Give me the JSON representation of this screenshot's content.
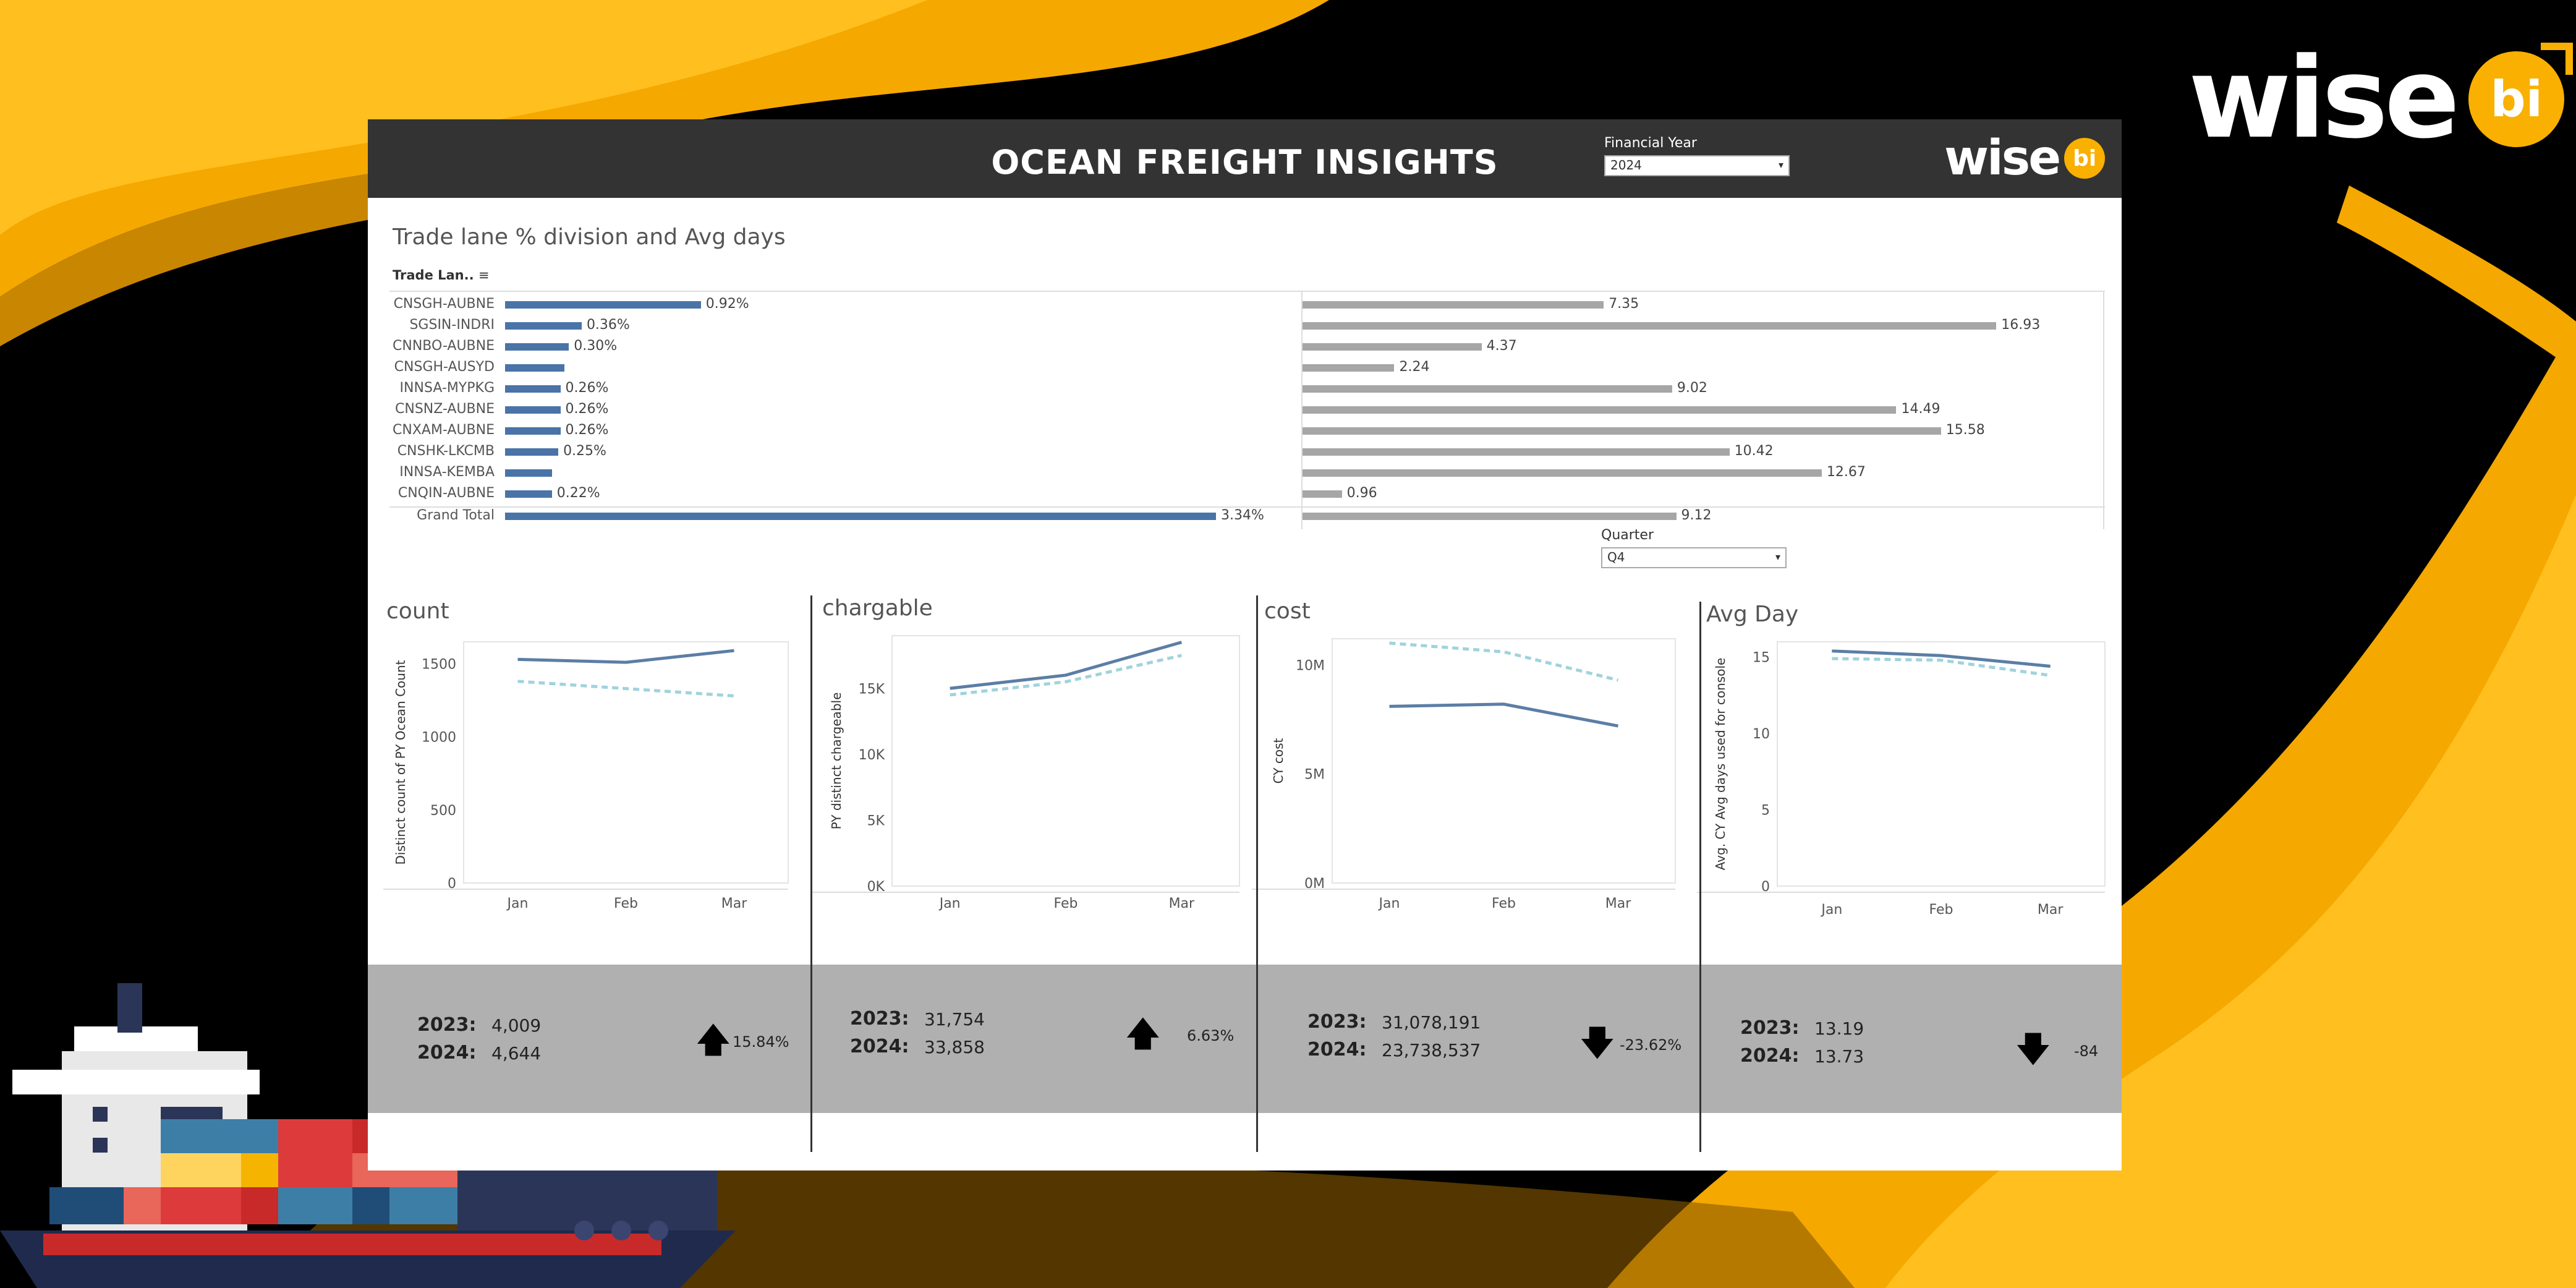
{
  "brand": {
    "word": "wise",
    "badge": "bi"
  },
  "header": {
    "title": "OCEAN FREIGHT INSIGHTS",
    "financial_year_label": "Financial Year",
    "financial_year_value": "2024"
  },
  "trade_section": {
    "title": "Trade lane % division and Avg days",
    "column_header": "Trade Lan..",
    "rows": [
      {
        "lane": "CNSGH-AUBNE",
        "pct": 0.92,
        "pct_label": "0.92%",
        "days": 7.35,
        "days_label": "7.35"
      },
      {
        "lane": "SGSIN-INDRI",
        "pct": 0.36,
        "pct_label": "0.36%",
        "days": 16.93,
        "days_label": "16.93"
      },
      {
        "lane": "CNNBO-AUBNE",
        "pct": 0.3,
        "pct_label": "0.30%",
        "days": 4.37,
        "days_label": "4.37"
      },
      {
        "lane": "CNSGH-AUSYD",
        "pct": 0.28,
        "pct_label": "",
        "days": 2.24,
        "days_label": "2.24"
      },
      {
        "lane": "INNSA-MYPKG",
        "pct": 0.26,
        "pct_label": "0.26%",
        "days": 9.02,
        "days_label": "9.02"
      },
      {
        "lane": "CNSNZ-AUBNE",
        "pct": 0.26,
        "pct_label": "0.26%",
        "days": 14.49,
        "days_label": "14.49"
      },
      {
        "lane": "CNXAM-AUBNE",
        "pct": 0.26,
        "pct_label": "0.26%",
        "days": 15.58,
        "days_label": "15.58"
      },
      {
        "lane": "CNSHK-LKCMB",
        "pct": 0.25,
        "pct_label": "0.25%",
        "days": 10.42,
        "days_label": "10.42"
      },
      {
        "lane": "INNSA-KEMBA",
        "pct": 0.22,
        "pct_label": "",
        "days": 12.67,
        "days_label": "12.67"
      },
      {
        "lane": "CNQIN-AUBNE",
        "pct": 0.22,
        "pct_label": "0.22%",
        "days": 0.96,
        "days_label": "0.96"
      }
    ],
    "grand_total": {
      "lane": "Grand Total",
      "pct": 3.34,
      "pct_label": "3.34%",
      "days": 9.12,
      "days_label": "9.12"
    }
  },
  "quarter": {
    "label": "Quarter",
    "value": "Q4"
  },
  "chart_data": [
    {
      "type": "line",
      "title": "count",
      "ylabel": "Distinct count of PY Ocean Count",
      "categories": [
        "Jan",
        "Feb",
        "Mar"
      ],
      "ylim": [
        0,
        1650
      ],
      "yticks": [
        0,
        500,
        1000,
        1500
      ],
      "ytick_labels": [
        "0",
        "500",
        "1000",
        "1500"
      ],
      "series": [
        {
          "values": [
            1530,
            1510,
            1590
          ],
          "color": "#5b7ea5",
          "style": "solid"
        },
        {
          "values": [
            1380,
            1330,
            1280
          ],
          "color": "#9fd3dc",
          "style": "dashed"
        }
      ]
    },
    {
      "type": "line",
      "title": "chargable",
      "ylabel": "PY distinct chargeable",
      "categories": [
        "Jan",
        "Feb",
        "Mar"
      ],
      "ylim": [
        0,
        19000
      ],
      "yticks": [
        0,
        5000,
        10000,
        15000
      ],
      "ytick_labels": [
        "0K",
        "5K",
        "10K",
        "15K"
      ],
      "series": [
        {
          "values": [
            15000,
            16000,
            18500
          ],
          "color": "#5b7ea5",
          "style": "solid"
        },
        {
          "values": [
            14500,
            15500,
            17500
          ],
          "color": "#9fd3dc",
          "style": "dashed"
        }
      ]
    },
    {
      "type": "line",
      "title": "cost",
      "ylabel": "CY cost",
      "categories": [
        "Jan",
        "Feb",
        "Mar"
      ],
      "ylim": [
        0,
        11200000
      ],
      "yticks": [
        0,
        5000000,
        10000000
      ],
      "ytick_labels": [
        "0M",
        "5M",
        "10M"
      ],
      "series": [
        {
          "values": [
            8100000,
            8200000,
            7200000
          ],
          "color": "#5b7ea5",
          "style": "solid"
        },
        {
          "values": [
            11000000,
            10600000,
            9300000
          ],
          "color": "#9fd3dc",
          "style": "dashed"
        }
      ]
    },
    {
      "type": "line",
      "title": "Avg Day",
      "ylabel": "Avg. CY Avg days used for console",
      "categories": [
        "Jan",
        "Feb",
        "Mar"
      ],
      "ylim": [
        0,
        16
      ],
      "yticks": [
        0,
        5,
        10,
        15
      ],
      "ytick_labels": [
        "0",
        "5",
        "10",
        "15"
      ],
      "series": [
        {
          "values": [
            15.4,
            15.1,
            14.4
          ],
          "color": "#5b7ea5",
          "style": "solid"
        },
        {
          "values": [
            14.9,
            14.8,
            13.8
          ],
          "color": "#9fd3dc",
          "style": "dashed"
        }
      ]
    }
  ],
  "kpis": [
    {
      "y1_label": "2023:",
      "y1_value": "4,009",
      "y2_label": "2024:",
      "y2_value": "4,644",
      "direction": "up",
      "pct": "15.84%"
    },
    {
      "y1_label": "2023:",
      "y1_value": "31,754",
      "y2_label": "2024:",
      "y2_value": "33,858",
      "direction": "up",
      "pct": "6.63%"
    },
    {
      "y1_label": "2023:",
      "y1_value": "31,078,191",
      "y2_label": "2024:",
      "y2_value": "23,738,537",
      "direction": "down",
      "pct": "-23.62%"
    },
    {
      "y1_label": "2023:",
      "y1_value": "13.19",
      "y2_label": "2024:",
      "y2_value": "13.73",
      "direction": "down",
      "pct": "-84"
    }
  ],
  "colors": {
    "accent": "#f9b000",
    "bar_blue": "#4a73a8",
    "bar_gray": "#a6a6a6",
    "header": "#333333",
    "kpi_band": "#b0b0b0"
  }
}
